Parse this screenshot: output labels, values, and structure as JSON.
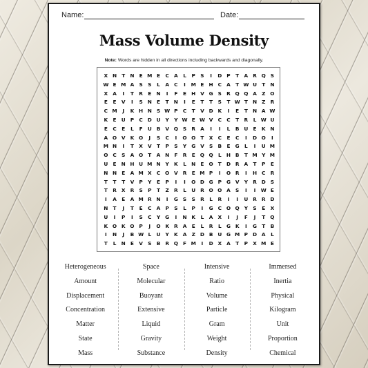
{
  "header": {
    "name_label": "Name:",
    "date_label": "Date:"
  },
  "title": "Mass Volume Density",
  "note": {
    "label": "Note:",
    "text": " Words are hidden in all directions including backwards and diagonally."
  },
  "grid": [
    "XNTNEMECALPSIDPTARQS",
    "WEMASSLACIMEHCATWUTN",
    "XAITRENIFEHVGSRQQAZO",
    "EEVISNETNIETTSTWTNZR",
    "CMJKHNSWPCTVDKIETNAW",
    "KEUPCDUYYWEWVCCTRLWU",
    "ECELFUBVQSRAIILBUEKN",
    "AOVKOJSCIOOTXCECIDOI",
    "MNITXVTPSYGVSBEGLIUM",
    "OCSAOTANFREQQLHBTMYM",
    "UENHUMNYKLNEOTDRATPE",
    "NNEAMXCOVREMPIORIHCR",
    "TTTVPYEPIIODGPGVYRDS",
    "TRXRSPTZRLUROOASIIWE",
    "IAEAMRNIGSSRLRIIURRD",
    "NTJTECAPSLPIGCOQYSEX",
    "UIPISCYGINKLAXIJFJTQ",
    "KOKOPJOKRAELRLGKIGTB",
    "INJBWLUYKAZDBUGMPDAL",
    "TLNEVSBRQFMIDXATPXME"
  ],
  "word_columns": [
    [
      "Heterogeneous",
      "Amount",
      "Displacement",
      "Concentration",
      "Matter",
      "State",
      "Mass"
    ],
    [
      "Space",
      "Molecular",
      "Buoyant",
      "Extensive",
      "Liquid",
      "Gravity",
      "Substance"
    ],
    [
      "Intensive",
      "Ratio",
      "Volume",
      "Particle",
      "Gram",
      "Weight",
      "Density"
    ],
    [
      "Immersed",
      "Inertia",
      "Physical",
      "Kilogram",
      "Unit",
      "Proportion",
      "Chemical"
    ]
  ]
}
